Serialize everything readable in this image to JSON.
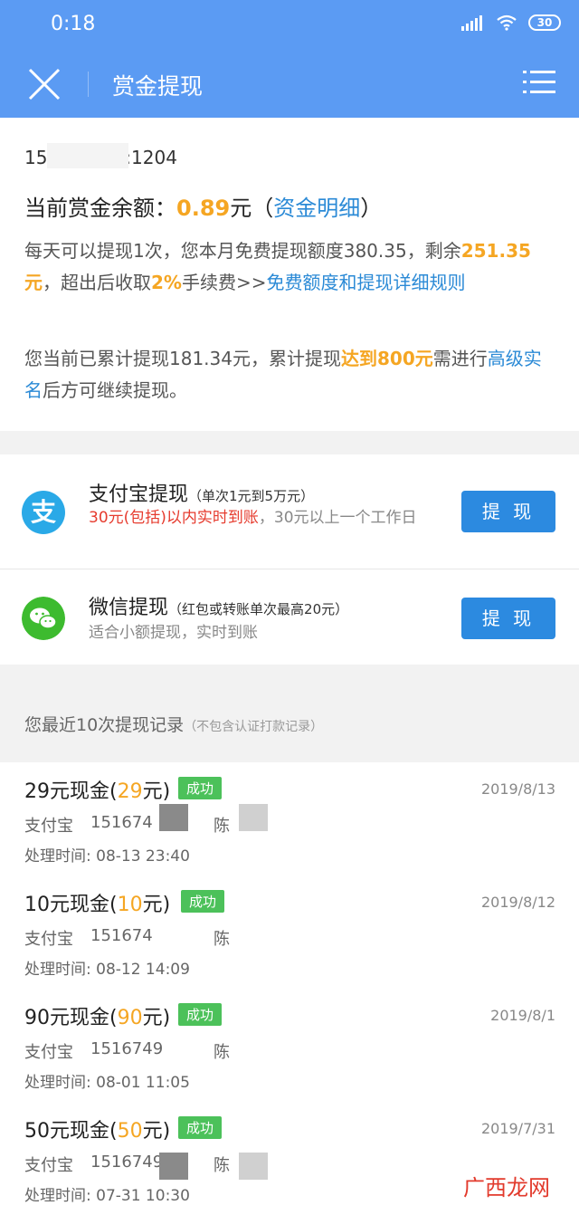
{
  "status_bar": {
    "time": "0:18",
    "battery": "30"
  },
  "nav": {
    "title": "赏金提现"
  },
  "account": {
    "user_line": "15        568（ID:1204"
  },
  "balance": {
    "label": "当前赏金余额：",
    "amount": "0.89",
    "unit": "元",
    "paren_open": "（",
    "detail_link": "资金明细",
    "paren_close": "）"
  },
  "rules": {
    "p1_a": "每天可以提现1次，您本月免费提现额度380.35，剩余",
    "p1_remaining": "251.35元",
    "p1_b": "，超出后收取",
    "p1_fee": "2%",
    "p1_c": "手续费>>",
    "p1_link": "免费额度和提现详细规则",
    "p2_a": "您当前已累计提现181.34元，累计提现",
    "p2_threshold": "达到800元",
    "p2_b": "需进行",
    "p2_link": "高级实名",
    "p2_c": "后方可继续提现。"
  },
  "methods": {
    "alipay": {
      "title": "支付宝提现",
      "note": "（单次1元到5万元）",
      "desc_red": "30元(包括)以内实时到账",
      "desc_rest": "，30元以上一个工作日",
      "button": "提 现",
      "icon_char": "支"
    },
    "wechat": {
      "title": "微信提现",
      "note_a": "（红包或转账单次最高",
      "note_red": "20元",
      "note_b": "）",
      "desc": "适合小额提现，实时到账",
      "button": "提 现"
    }
  },
  "records": {
    "header": "您最近10次提现记录",
    "header_note": "（不包含认证打款记录）",
    "items": [
      {
        "title_a": "29元现金(",
        "amount": "29",
        "title_b": "元)",
        "badge": "成功",
        "date": "2019/8/13",
        "account": "支付宝",
        "acct_num": "151674",
        "name": "陈",
        "time": "处理时间: 08-13 23:40"
      },
      {
        "title_a": "10元现金(",
        "amount": "10",
        "title_b": "元)",
        "badge": "成功",
        "date": "2019/8/12",
        "account": "支付宝",
        "acct_num": "151674",
        "name": "陈",
        "time": "处理时间: 08-12 14:09"
      },
      {
        "title_a": "90元现金(",
        "amount": "90",
        "title_b": "元)",
        "badge": "成功",
        "date": "2019/8/1",
        "account": "支付宝",
        "acct_num": "1516749",
        "name": "陈",
        "time": "处理时间: 08-01 11:05"
      },
      {
        "title_a": "50元现金(",
        "amount": "50",
        "title_b": "元)",
        "badge": "成功",
        "date": "2019/7/31",
        "account": "支付宝",
        "acct_num": "1516749",
        "name": "陈",
        "time": "处理时间: 07-31 10:30"
      }
    ]
  },
  "watermark": "广西龙网",
  "colors": {
    "nav_blue": "#5b9bf3",
    "accent_orange": "#f5a623",
    "link_blue": "#2b8ad6",
    "success_green": "#4cc15a",
    "button_blue": "#2c8ae0"
  }
}
